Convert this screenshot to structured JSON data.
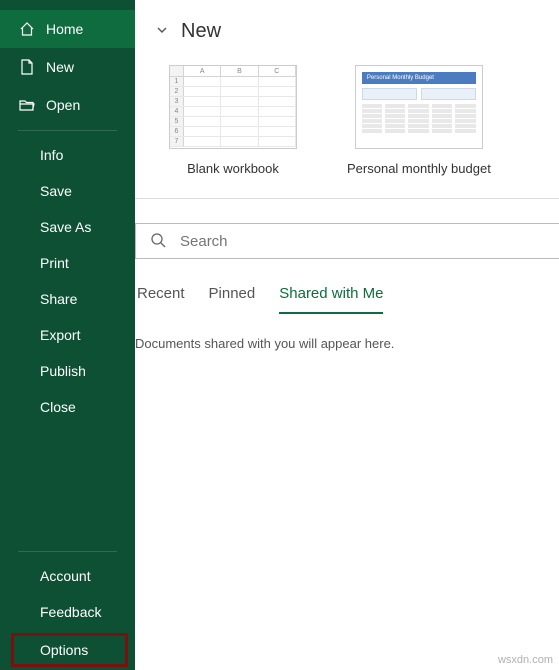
{
  "sidebar": {
    "home": "Home",
    "new": "New",
    "open": "Open",
    "info": "Info",
    "save": "Save",
    "saveas": "Save As",
    "print": "Print",
    "share": "Share",
    "export": "Export",
    "publish": "Publish",
    "close": "Close",
    "account": "Account",
    "feedback": "Feedback",
    "options": "Options"
  },
  "main": {
    "section_title": "New",
    "templates": {
      "blank": "Blank workbook",
      "budget": "Personal monthly budget",
      "budget_thumb_title": "Personal Monthly Budget"
    },
    "search": {
      "placeholder": "Search"
    },
    "tabs": {
      "recent": "Recent",
      "pinned": "Pinned",
      "shared": "Shared with Me"
    },
    "empty": "Documents shared with you will appear here."
  },
  "watermark": "wsxdn.com"
}
